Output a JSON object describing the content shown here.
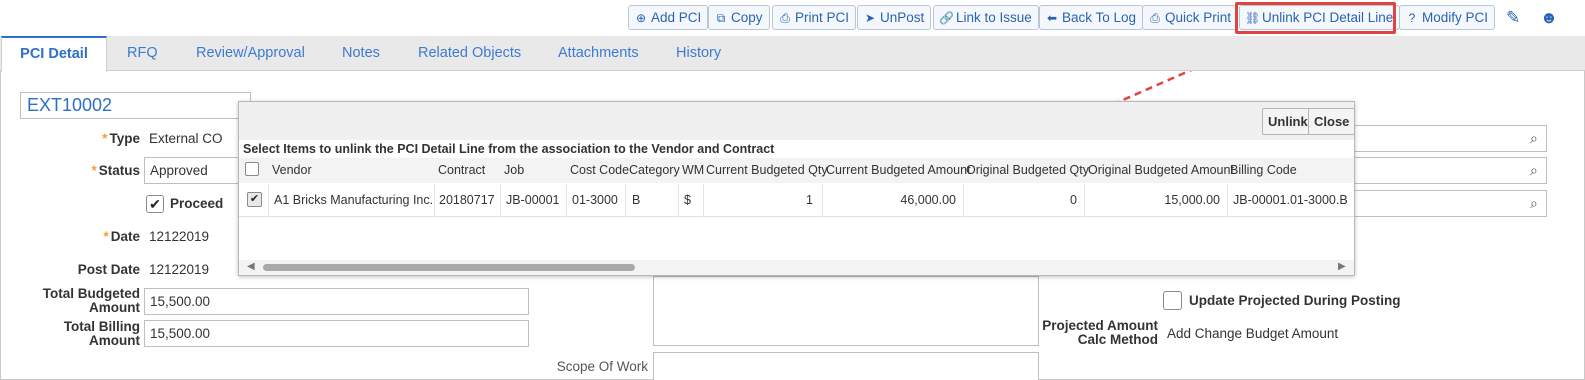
{
  "toolbar": {
    "buttons": [
      {
        "label": "Add PCI",
        "icon": "plus-circle-icon",
        "glyph": "⊕"
      },
      {
        "label": "Copy",
        "icon": "copy-icon",
        "glyph": "⧉"
      },
      {
        "label": "Print PCI",
        "icon": "print-icon",
        "glyph": "⎙"
      },
      {
        "label": "UnPost",
        "icon": "paper-plane-icon",
        "glyph": "➤"
      },
      {
        "label": "Link to Issue",
        "icon": "link-icon",
        "glyph": "🔗"
      },
      {
        "label": "Back To Log",
        "icon": "arrow-left-icon",
        "glyph": "⬅"
      },
      {
        "label": "Quick Print",
        "icon": "print-icon",
        "glyph": "⎙"
      },
      {
        "label": "Unlink PCI Detail Line",
        "icon": "unlink-icon",
        "glyph": "⛓"
      },
      {
        "label": "Modify PCI",
        "icon": "question-circle-icon",
        "glyph": "?"
      }
    ],
    "edit_glyph": "✎",
    "user_glyph": "☻",
    "highlight_color": "#e0443e"
  },
  "tabs": [
    "PCI Detail",
    "RFQ",
    "Review/Approval",
    "Notes",
    "Related Objects",
    "Attachments",
    "History"
  ],
  "form": {
    "pci_id": "EXT10002",
    "type_label": "Type",
    "type_value": "External CO",
    "status_label": "Status",
    "status_value": "Approved",
    "proceed_label": "Proceed",
    "date_label": "Date",
    "date_value": "12122019",
    "post_date_label": "Post Date",
    "post_date_value": "12122019",
    "total_budgeted_label_1": "Total Budgeted",
    "total_budgeted_label_2": "Amount",
    "total_budgeted_value": "15,500.00",
    "total_billing_label_1": "Total Billing",
    "total_billing_label_2": "Amount",
    "total_billing_value": "15,500.00",
    "scope_label": "Scope Of Work",
    "update_projected_label": "Update Projected During Posting",
    "projected_calc_label_1": "Projected Amount",
    "projected_calc_label_2": "Calc Method",
    "projected_calc_value": "Add Change Budget Amount",
    "required_mark": "*"
  },
  "modal": {
    "unlink_label": "Unlink",
    "close_label": "Close",
    "message": "Select Items to unlink the PCI Detail Line from the association to the Vendor and Contract",
    "columns": [
      "Vendor",
      "Contract",
      "Job",
      "Cost Code",
      "Category",
      "WM",
      "Current Budgeted Qty",
      "Current Budgeted Amount",
      "Original Budgeted Qty",
      "Original Budgeted Amount",
      "Billing Code"
    ],
    "row": {
      "checked": "✔",
      "vendor": "A1 Bricks Manufacturing Inc.",
      "contract": "20180717",
      "job": "JB-00001",
      "cost_code": "01-3000",
      "category": "B",
      "wm": "$",
      "current_qty": "1",
      "current_amount": "46,000.00",
      "original_qty": "0",
      "original_amount": "15,000.00",
      "billing_code": "JB-00001.01-3000.B"
    }
  }
}
